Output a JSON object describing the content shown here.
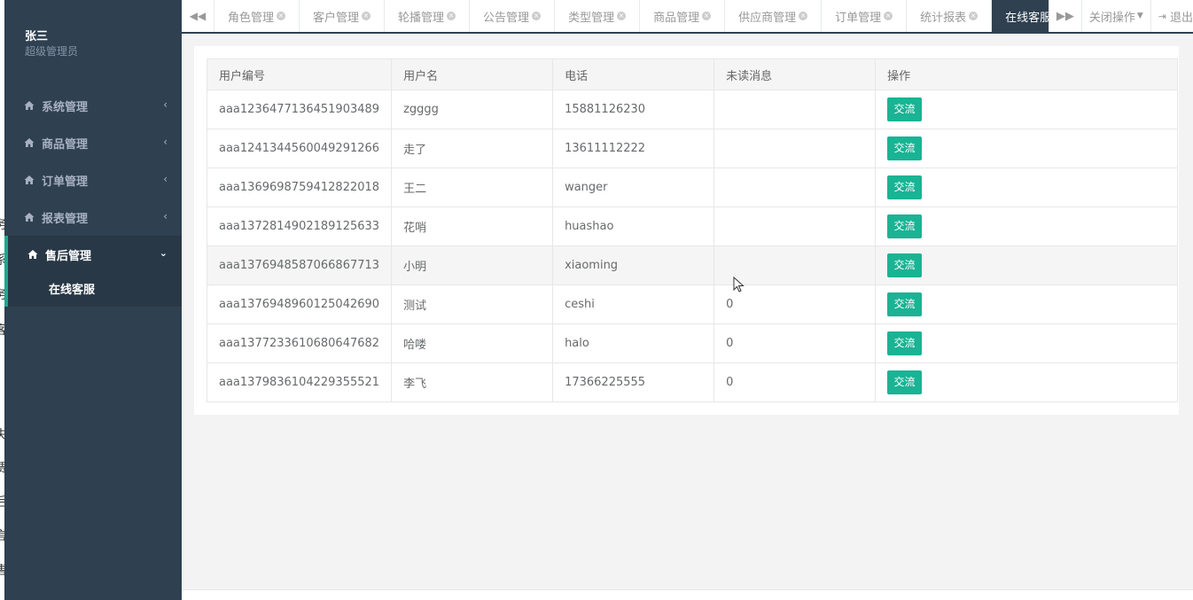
{
  "left_strip_chars": [
    "·",
    "·",
    "务",
    "系",
    "务",
    "客",
    "·",
    "·",
    "失",
    "赁",
    "后",
    "言",
    "售"
  ],
  "user": {
    "name": "张三",
    "role": "超级管理员"
  },
  "nav": {
    "items": [
      {
        "label": "系统管理",
        "icon": "home-icon"
      },
      {
        "label": "商品管理",
        "icon": "home-icon"
      },
      {
        "label": "订单管理",
        "icon": "home-icon"
      },
      {
        "label": "报表管理",
        "icon": "home-icon"
      }
    ],
    "active": {
      "label": "售后管理",
      "icon": "home-icon",
      "sub": "在线客服"
    }
  },
  "tabs": [
    {
      "label": "角色管理"
    },
    {
      "label": "客户管理"
    },
    {
      "label": "轮播管理"
    },
    {
      "label": "公告管理"
    },
    {
      "label": "类型管理"
    },
    {
      "label": "商品管理"
    },
    {
      "label": "供应商管理"
    },
    {
      "label": "订单管理"
    },
    {
      "label": "统计报表"
    },
    {
      "label": "在线客服",
      "active": true
    }
  ],
  "toolbar": {
    "close_ops": "关闭操作",
    "logout": "退出"
  },
  "table": {
    "headers": [
      "用户编号",
      "用户名",
      "电话",
      "未读消息",
      "操作"
    ],
    "rows": [
      {
        "id": "aaa1236477136451903489",
        "name": "zgggg",
        "phone": "15881126230",
        "unread": "",
        "action": "交流"
      },
      {
        "id": "aaa1241344560049291266",
        "name": "走了",
        "phone": "13611112222",
        "unread": "",
        "action": "交流"
      },
      {
        "id": "aaa1369698759412822018",
        "name": "王二",
        "phone": "wanger",
        "unread": "",
        "action": "交流"
      },
      {
        "id": "aaa1372814902189125633",
        "name": "花哨",
        "phone": "huashao",
        "unread": "",
        "action": "交流"
      },
      {
        "id": "aaa1376948587066867713",
        "name": "小明",
        "phone": "xiaoming",
        "unread": "",
        "action": "交流"
      },
      {
        "id": "aaa1376948960125042690",
        "name": "测试",
        "phone": "ceshi",
        "unread": "0",
        "action": "交流"
      },
      {
        "id": "aaa1377233610680647682",
        "name": "哈喽",
        "phone": "halo",
        "unread": "0",
        "action": "交流"
      },
      {
        "id": "aaa1379836104229355521",
        "name": "李飞",
        "phone": "17366225555",
        "unread": "0",
        "action": "交流"
      }
    ]
  },
  "colors": {
    "sidebar": "#2f4050",
    "accent": "#1ab394"
  }
}
